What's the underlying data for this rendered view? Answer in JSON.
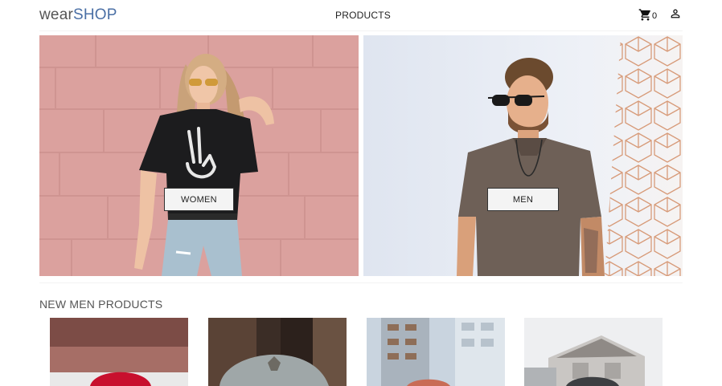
{
  "header": {
    "logo_part1": "wear",
    "logo_part2": "SHOP",
    "nav_products": "PRODUCTS",
    "cart_icon": "cart-icon",
    "cart_count": "0",
    "account_icon": "person-icon"
  },
  "hero": {
    "women_label": "WOMEN",
    "men_label": "MEN"
  },
  "section": {
    "title": "NEW MEN PRODUCTS"
  },
  "colors": {
    "brand": "#4a6fa5",
    "women_backdrop": "#dca3a0",
    "men_backdrop": "#e8ecf4"
  }
}
